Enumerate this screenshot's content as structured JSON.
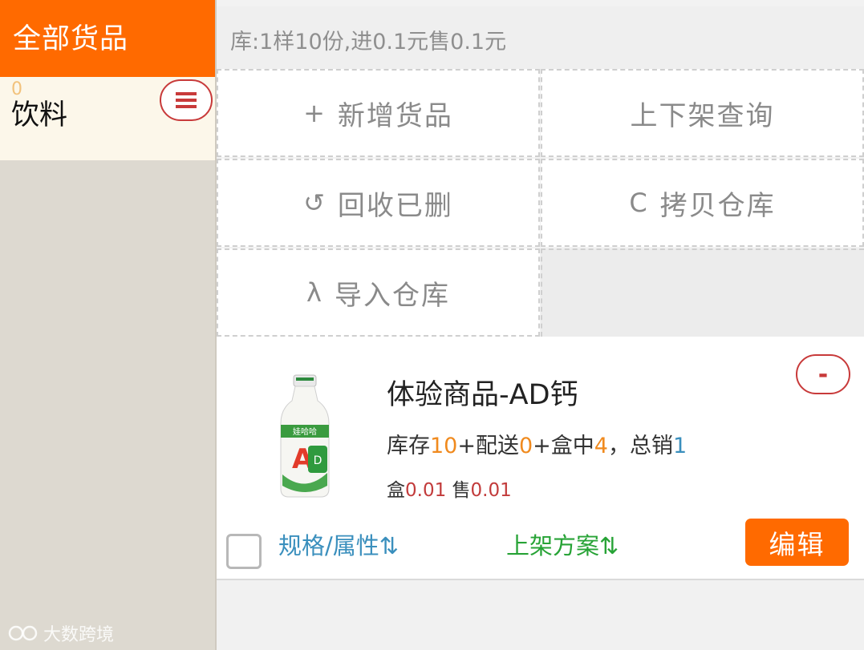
{
  "sidebar": {
    "header": "全部货品",
    "categories": [
      {
        "count": "0",
        "name": "饮料",
        "menu_icon": "hamburger-icon"
      }
    ]
  },
  "summary": "库:1样10份,进0.1元售0.1元",
  "actions": [
    {
      "glyph": "+",
      "label": "新增货品"
    },
    {
      "glyph": "",
      "label": "上下架查询"
    },
    {
      "glyph": "↺",
      "label": "回收已删"
    },
    {
      "glyph": "C",
      "label": "拷贝仓库"
    },
    {
      "glyph": "λ",
      "label": "导入仓库"
    }
  ],
  "product": {
    "title": "体验商品-AD钙",
    "stock": {
      "stock_label": "库存",
      "stock_value": "10",
      "delivery_label": "+配送",
      "delivery_value": "0",
      "box_label": "+盒中",
      "box_value": "4",
      "sold_label": "，总销",
      "sold_value": "1"
    },
    "price": {
      "box_label": "盒",
      "box_value": "0.01",
      "sale_label": "售",
      "sale_value": "0.01"
    },
    "remove_label": "-",
    "spec_link": "规格/属性⇅",
    "plan_link": "上架方案⇅",
    "edit_label": "编辑",
    "image_icon": "ad-calcium-bottle-image"
  },
  "watermark": "大数跨境",
  "colors": {
    "accent": "#ff6a00",
    "danger": "#c83a3a",
    "link_blue": "#3a8fbd",
    "link_green": "#27a336"
  }
}
